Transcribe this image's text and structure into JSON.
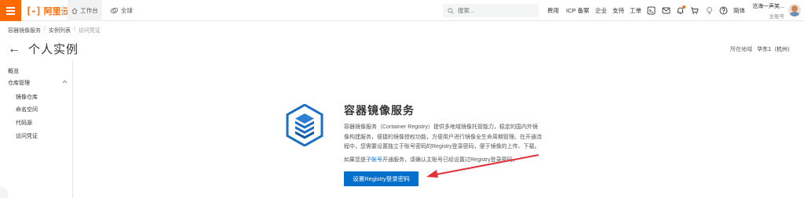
{
  "topbar": {
    "logo_mark": "[-]",
    "logo_text": "阿里云",
    "home_label": "工作台",
    "global_label": "全球",
    "search_placeholder": "搜索...",
    "links": {
      "billing": "费用",
      "icp": "ICP 备案",
      "enterprise": "企业",
      "support": "支持",
      "ticket": "工单",
      "language": "简体"
    },
    "account_name": "沧海一声笑...",
    "account_sub": "主账号"
  },
  "breadcrumb": {
    "items": [
      "容器镜像服务",
      "实例列表",
      "访问凭证"
    ],
    "separator": "/"
  },
  "page": {
    "back_icon": "arrow-left-icon",
    "title": "个人实例",
    "region_label": "所在地域",
    "region_value": "华东1（杭州）"
  },
  "sidebar": {
    "overview": "概览",
    "repo_group": "仓库管理",
    "repo_items": [
      "镜像仓库",
      "命名空间",
      "代码源"
    ],
    "access_credential": "访问凭证"
  },
  "main": {
    "title": "容器镜像服务",
    "description": "容器镜像服务（Container Registry）提供多地域镜像托管能力，稳定的国内外镜像构建服务，便捷的镜像授权功能，方便用户进行镜像全生命周期管理。在开通流程中，您需要设置独立于账号密码的Registry登录密码，便于镜像的上传、下载。",
    "note_prefix": "如果您是",
    "note_link": "子账号",
    "note_suffix": "开通服务，请确认主账号已经设置过Registry登录密码。",
    "button_label": "设置Registry登录密码"
  },
  "colors": {
    "brand": "#ff6a00",
    "primary": "#0070cc",
    "annotation_arrow": "#e0323c"
  }
}
